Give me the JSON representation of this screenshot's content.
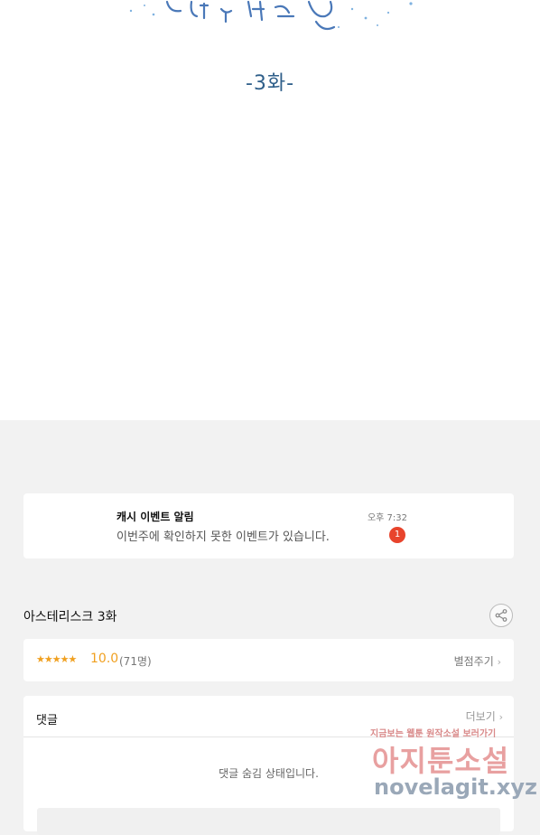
{
  "viewer": {
    "episode_title": "-3화-"
  },
  "notification": {
    "title": "캐시 이벤트 알림",
    "message": "이번주에 확인하지 못한 이벤트가 있습니다.",
    "time": "오후 7:32",
    "badge_count": "1"
  },
  "series": {
    "title": "아스테리스크 3화",
    "share_icon": "share-icon"
  },
  "rating": {
    "stars": "★★★★★",
    "score": "10.0",
    "count": "(71명)",
    "rate_label": "별점주기",
    "accent": "#f0a020"
  },
  "comments": {
    "heading": "댓글",
    "more_label": "더보기",
    "hidden_message": "댓글 숨김 상태입니다."
  },
  "watermark": {
    "tagline": "지금보는 웹툰 원작소설 보러가기",
    "brand": "아지툰소설",
    "url": "novelagit.xyz"
  }
}
